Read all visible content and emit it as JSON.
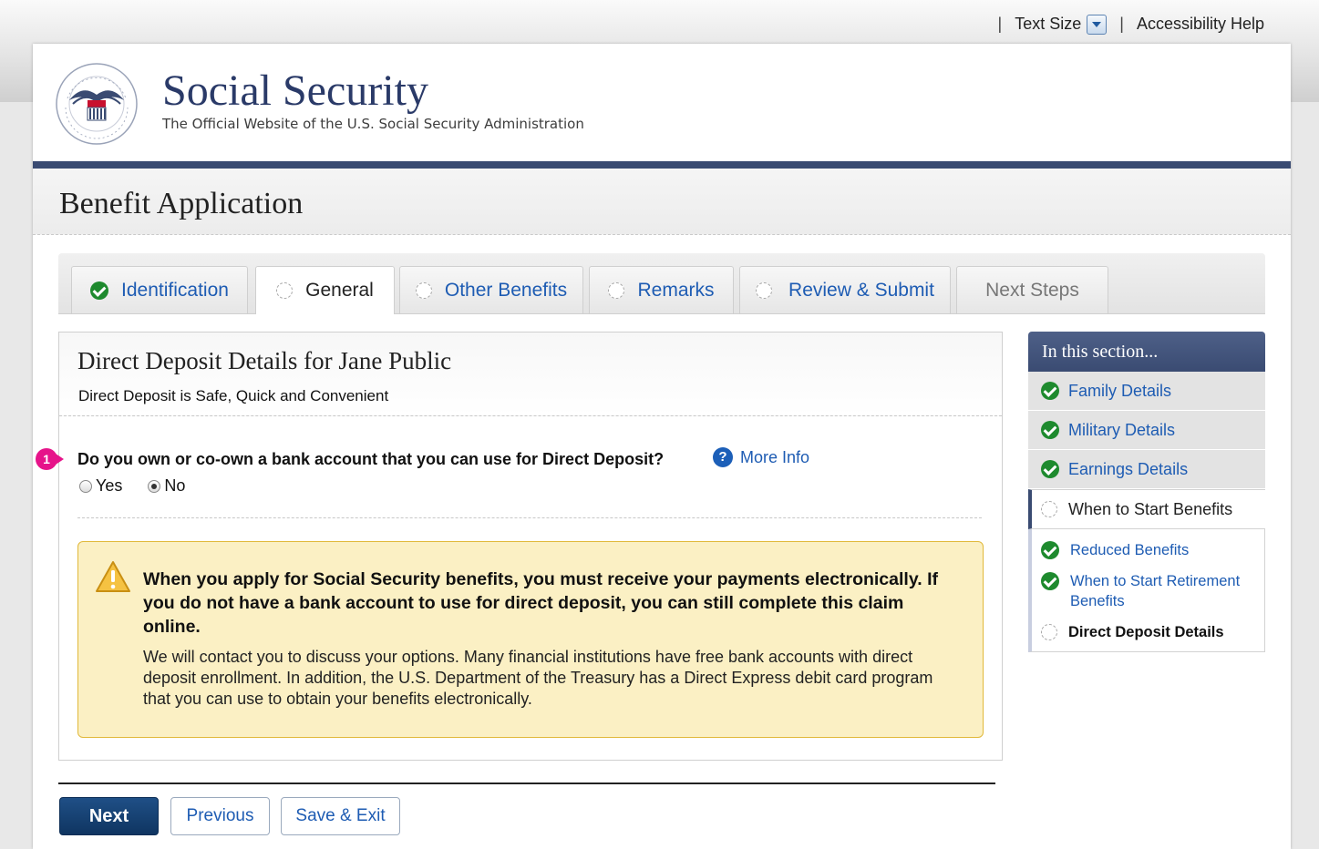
{
  "utility": {
    "text_size": "Text Size",
    "separator": "|",
    "accessibility_help": "Accessibility Help"
  },
  "header": {
    "brand": "Social Security",
    "tagline": "The Official Website of the U.S. Social Security Administration"
  },
  "page_title": "Benefit Application",
  "tabs": [
    {
      "label": "Identification",
      "status": "complete"
    },
    {
      "label": "General",
      "status": "current"
    },
    {
      "label": "Other Benefits",
      "status": "pending"
    },
    {
      "label": "Remarks",
      "status": "pending"
    },
    {
      "label": "Review & Submit",
      "status": "pending"
    },
    {
      "label": "Next Steps",
      "status": "disabled"
    }
  ],
  "section": {
    "title": "Direct Deposit Details for Jane Public",
    "subtitle": "Direct Deposit is Safe, Quick and Convenient",
    "question_number": "1",
    "question": "Do you own or co-own a bank account that you can use for Direct Deposit?",
    "more_info": "More Info",
    "options": [
      {
        "label": "Yes",
        "selected": false
      },
      {
        "label": "No",
        "selected": true
      }
    ],
    "alert_bold": "When you apply for Social Security benefits, you must receive your payments electronically.  If you do not have a bank account to use for direct deposit, you can still complete this claim online.",
    "alert_text": "We will contact you to discuss your options. Many financial institutions have free bank accounts with direct deposit enrollment.  In addition, the U.S. Department of the Treasury has a Direct Express debit card program that you can use to obtain your benefits electronically."
  },
  "buttons": {
    "next": "Next",
    "previous": "Previous",
    "save_exit": "Save & Exit"
  },
  "sidebar": {
    "heading": "In this section...",
    "items": [
      {
        "label": "Family Details",
        "status": "complete"
      },
      {
        "label": "Military Details",
        "status": "complete"
      },
      {
        "label": "Earnings Details",
        "status": "complete"
      },
      {
        "label": "When to Start Benefits",
        "status": "current"
      }
    ],
    "subitems": [
      {
        "label": "Reduced Benefits",
        "status": "complete"
      },
      {
        "label": "When to Start Retirement Benefits",
        "status": "complete"
      },
      {
        "label": "Direct Deposit Details",
        "status": "current"
      }
    ]
  },
  "colors": {
    "brand_navy": "#3a4b72",
    "link_blue": "#1e5cb3",
    "check_green": "#1e8a2e",
    "alert_bg": "#fbf0c4",
    "question_marker": "#e6148a"
  }
}
